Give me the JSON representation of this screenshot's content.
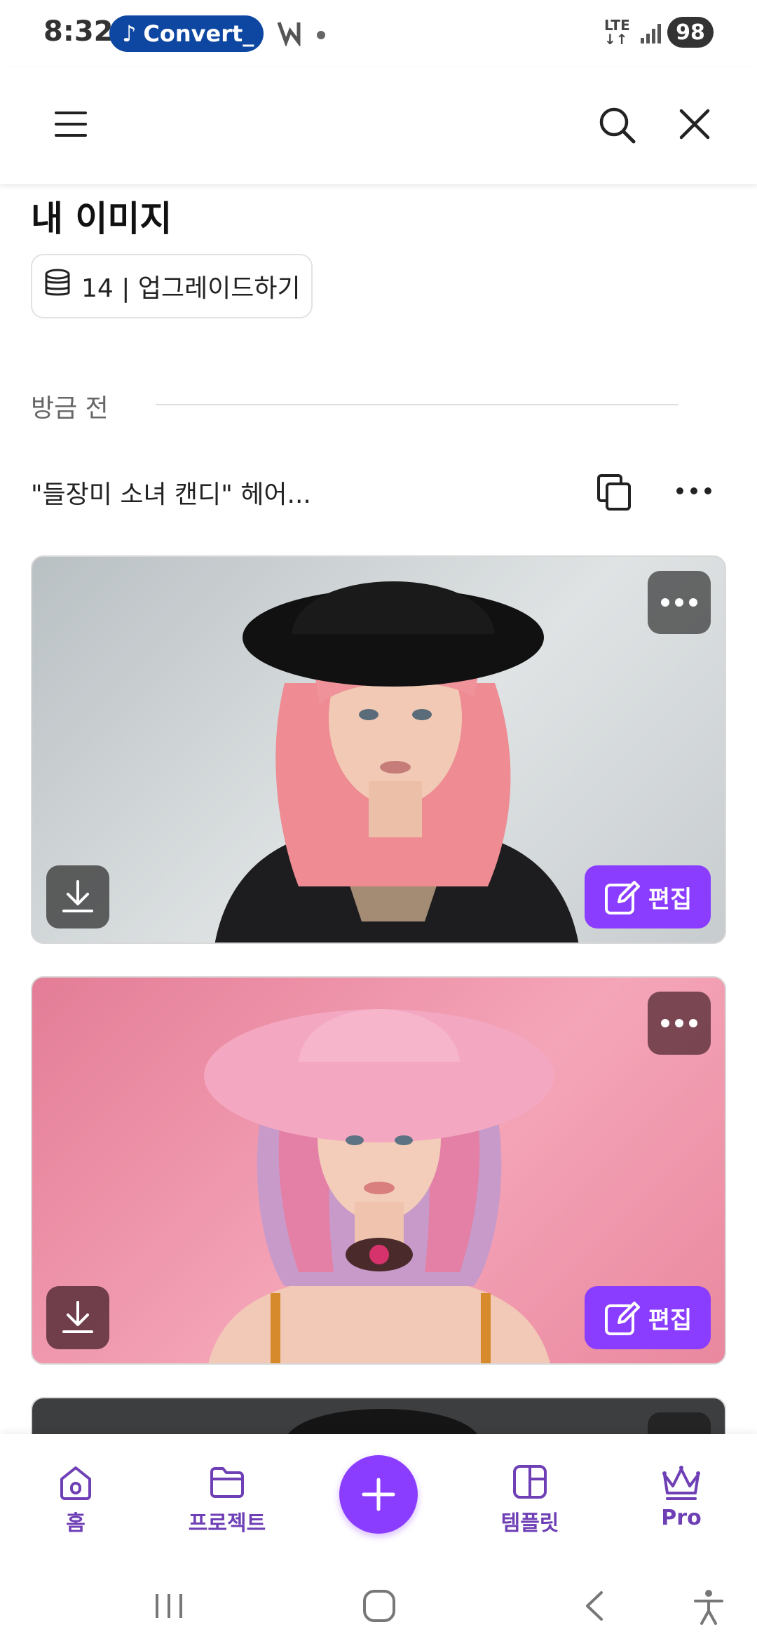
{
  "status_bar": {
    "time": "8:32",
    "notification_app": "Convert_",
    "network": "LTE",
    "battery": "98"
  },
  "app_bar": {
    "menu_icon": "menu-icon",
    "search_icon": "search-icon",
    "close_icon": "close-icon"
  },
  "page": {
    "title": "내 이미지",
    "credits_label": "14 | 업그레이드하기"
  },
  "section": {
    "label": "방금 전"
  },
  "generation": {
    "prompt": "\"들장미 소녀 캔디\" 헤어...",
    "cards": [
      {
        "edit_label": "편집",
        "image_desc": "pink-haired woman in black hat"
      },
      {
        "edit_label": "편집",
        "image_desc": "pink and lavender haired woman in pink hat"
      }
    ]
  },
  "bottom_nav": {
    "items": [
      {
        "label": "홈",
        "icon": "home-icon"
      },
      {
        "label": "프로젝트",
        "icon": "folder-icon"
      },
      {
        "label": "템플릿",
        "icon": "template-icon"
      },
      {
        "label": "Pro",
        "icon": "crown-icon"
      }
    ]
  },
  "colors": {
    "accent": "#8b3dff",
    "nav_text": "#6e3fb5"
  }
}
